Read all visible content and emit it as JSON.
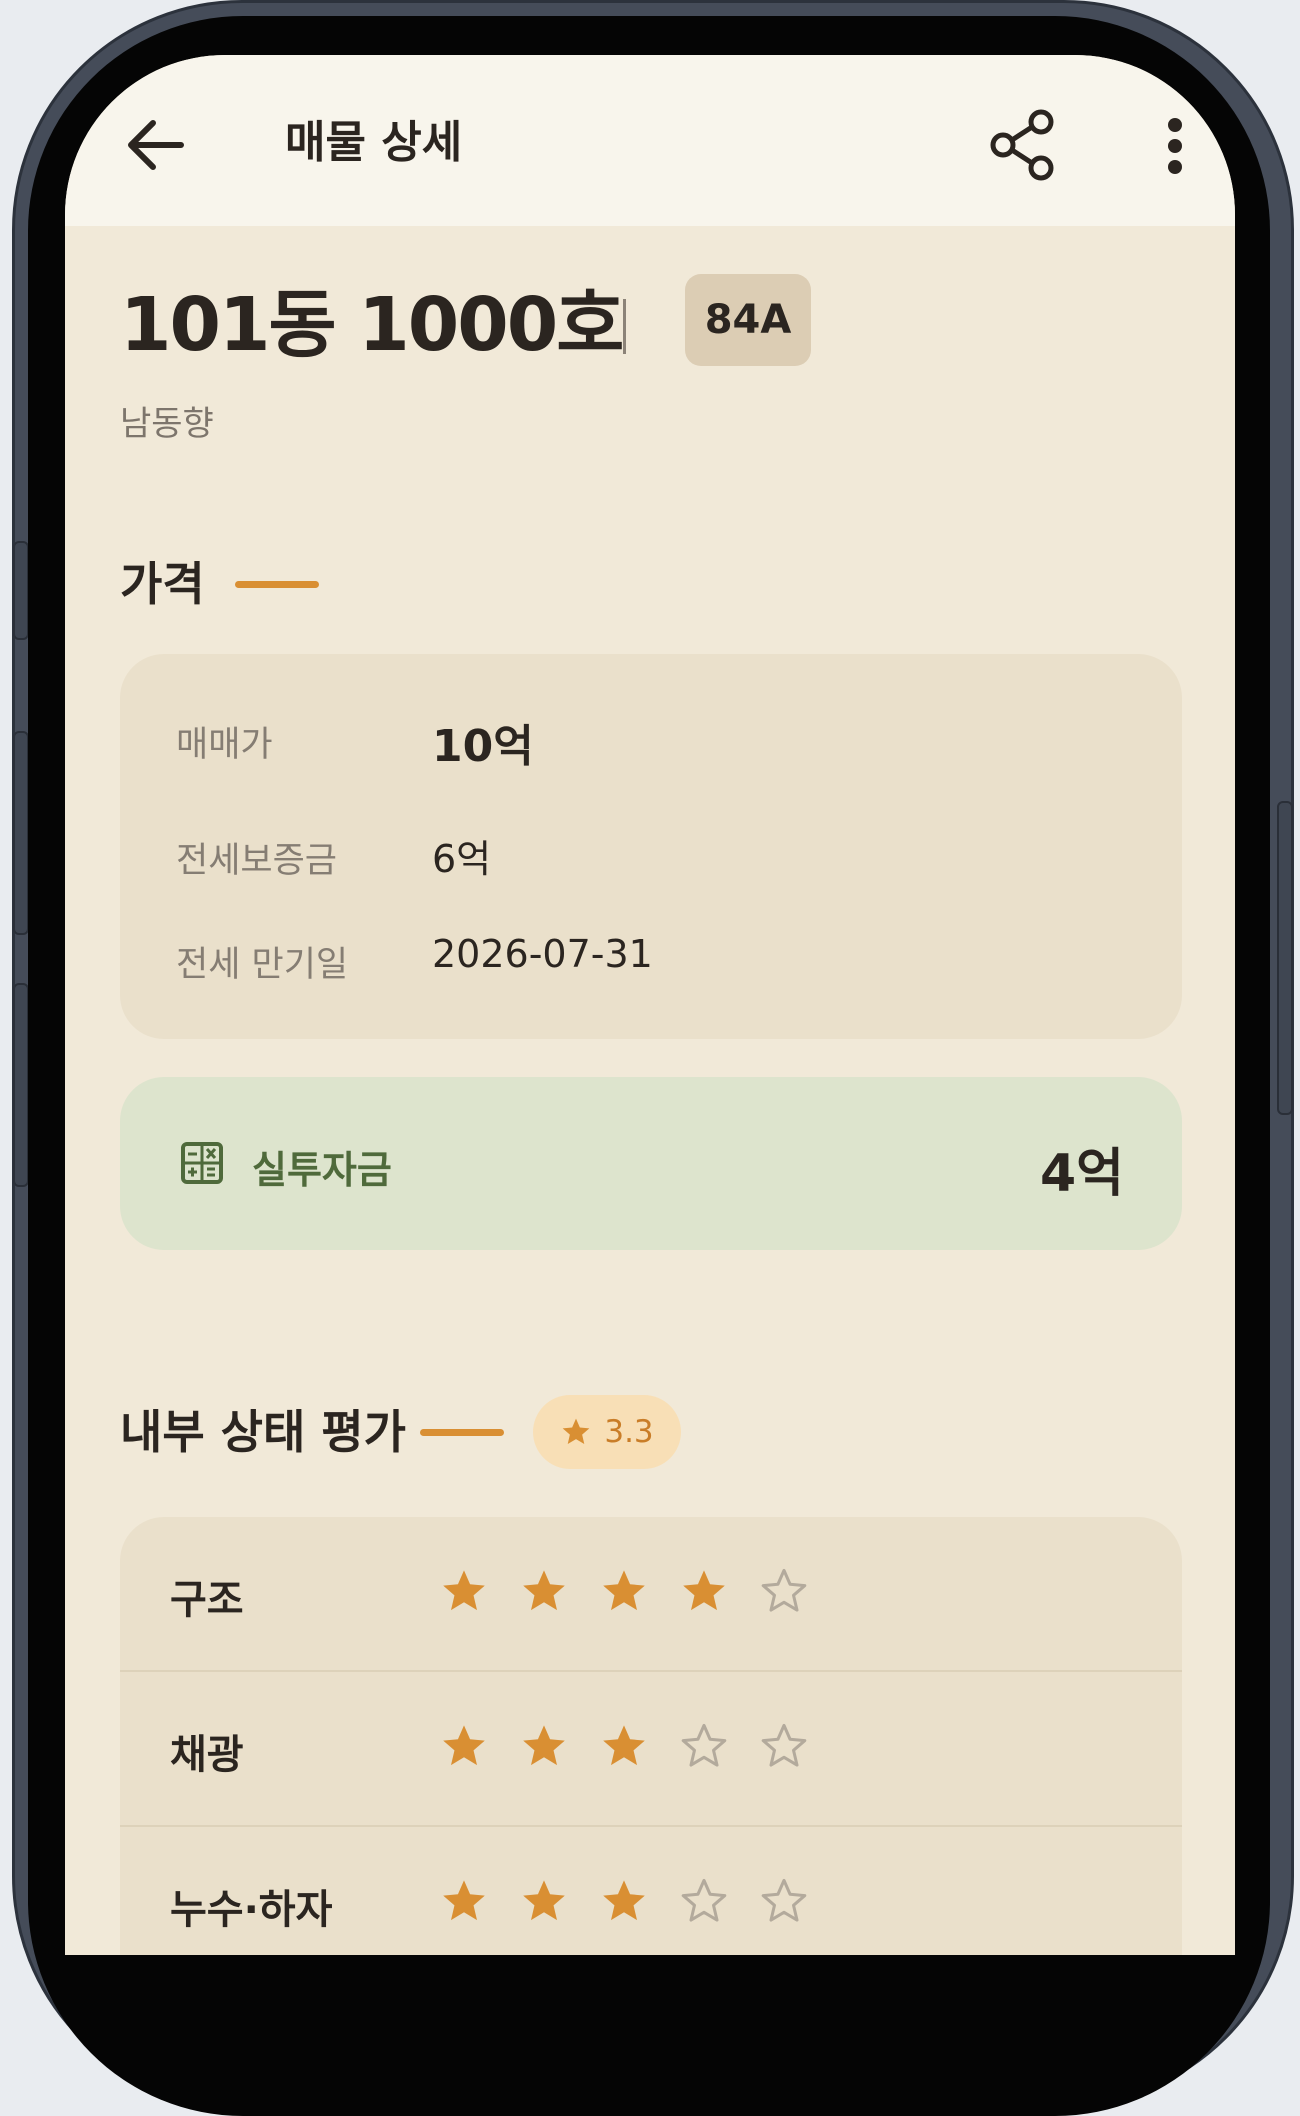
{
  "app_bar": {
    "title": "매물 상세",
    "back_icon": "arrow-left-icon",
    "share_icon": "share-icon",
    "more_icon": "more-vertical-icon"
  },
  "listing": {
    "unit": "101동 1000호",
    "type": "84A",
    "direction": "남동향"
  },
  "price_section": {
    "title": "가격",
    "rows": [
      {
        "label": "매매가",
        "value": "10억"
      },
      {
        "label": "전세보증금",
        "value": "6억"
      },
      {
        "label": "전세 만기일",
        "value": "2026-07-31"
      }
    ]
  },
  "investment": {
    "icon": "calculator-icon",
    "label": "실투자금",
    "value": "4억"
  },
  "evaluation": {
    "title": "내부 상태 평가",
    "average": "3.3",
    "items": [
      {
        "label": "구조",
        "rating": 4,
        "max": 5
      },
      {
        "label": "채광",
        "rating": 3,
        "max": 5
      },
      {
        "label": "누수·하자",
        "rating": 3,
        "max": 5
      }
    ]
  },
  "colors": {
    "accent": "#d98f33",
    "background": "#f1e9d8",
    "card": "#eae0cb",
    "investment_card": "#dde4cd",
    "investment_text": "#4f6a3b",
    "chip": "#dccdb4"
  }
}
